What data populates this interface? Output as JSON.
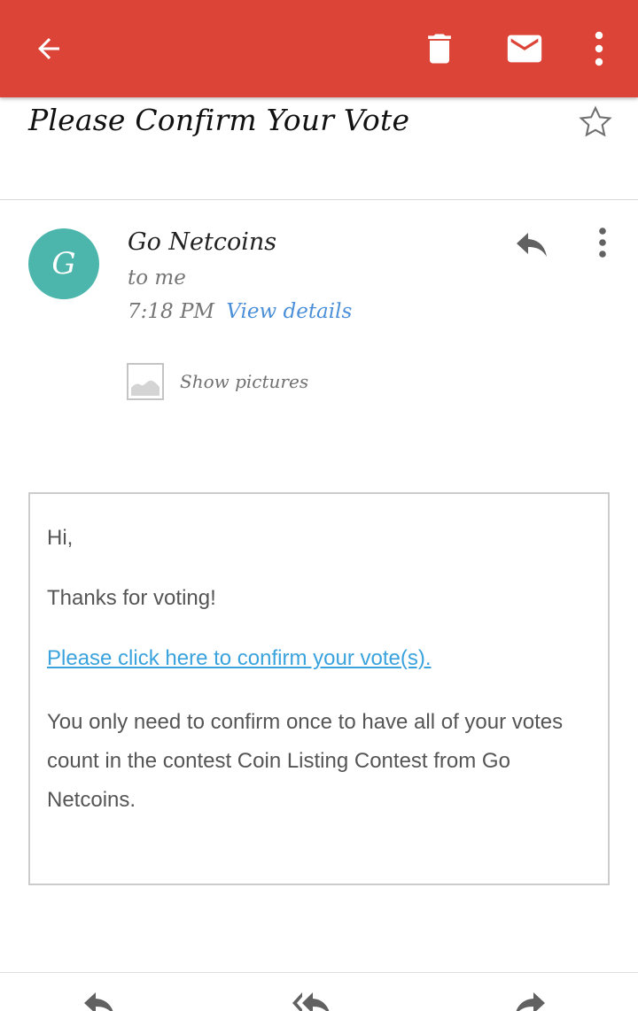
{
  "toolbar": {
    "background": "#db4437",
    "back_icon": "arrow-back-icon",
    "delete_icon": "trash-icon",
    "mark_unread_icon": "mail-icon",
    "more_icon": "more-vert-icon"
  },
  "subject": {
    "text": "Please Confirm Your Vote",
    "star_icon": "star-outline-icon"
  },
  "message": {
    "avatar_letter": "G",
    "avatar_color": "#4db6ac",
    "sender": "Go Netcoins",
    "recipient": "to me",
    "time": "7:18 PM",
    "view_details": "View details",
    "show_pictures": "Show pictures"
  },
  "body": {
    "greeting": "Hi,",
    "thanks": "Thanks for voting!",
    "confirm_link": "Please click here to confirm your vote(s).",
    "paragraph": "You only need to confirm once to have all of your votes count in the contest Coin Listing Contest from Go Netcoins."
  },
  "bottom_bar": {
    "reply_icon": "reply-icon",
    "reply_all_icon": "reply-all-icon",
    "forward_icon": "forward-icon"
  },
  "colors": {
    "accent": "#db4437",
    "link": "#3aa3dd",
    "details_link": "#4a8fd8"
  }
}
